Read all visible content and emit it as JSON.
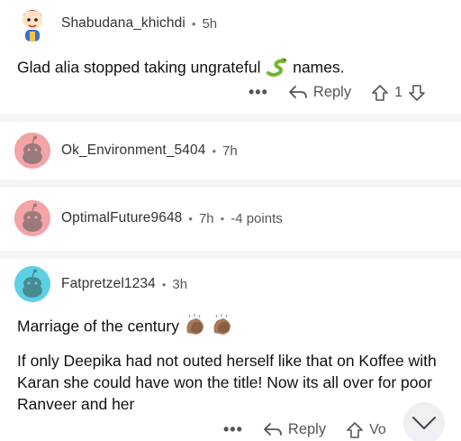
{
  "comments": [
    {
      "username": "Shabudana_khichdi",
      "age": "5h",
      "body": "Glad alia stopped taking ungrateful",
      "body_suffix": "names.",
      "reply_label": "Reply",
      "votes": "1",
      "more_label": "•••"
    },
    {
      "username": "Ok_Environment_5404",
      "age": "7h"
    },
    {
      "username": "OptimalFuture9648",
      "age": "7h",
      "points": "-4 points"
    },
    {
      "username": "Fatpretzel1234",
      "age": "3h",
      "line1": "Marriage of the century",
      "para2": "If only Deepika had not outed herself like that on Koffee with Karan she could have won the title! Now its all over for poor Ranveer and her",
      "reply_label": "Reply",
      "vote_label": "Vo",
      "more_label": "•••"
    }
  ],
  "colors": {
    "separator": "#f4f5f7",
    "avatar_pink": "#f4a3a6",
    "avatar_teal": "#5ed0e6",
    "avatar_bg_1": "#ffffff"
  },
  "icons": [
    "snake-emoji",
    "clapping-hands-emoji",
    "reply-arrow-icon",
    "upvote-icon",
    "downvote-icon",
    "chevron-down-icon"
  ],
  "separator_dot": "•"
}
